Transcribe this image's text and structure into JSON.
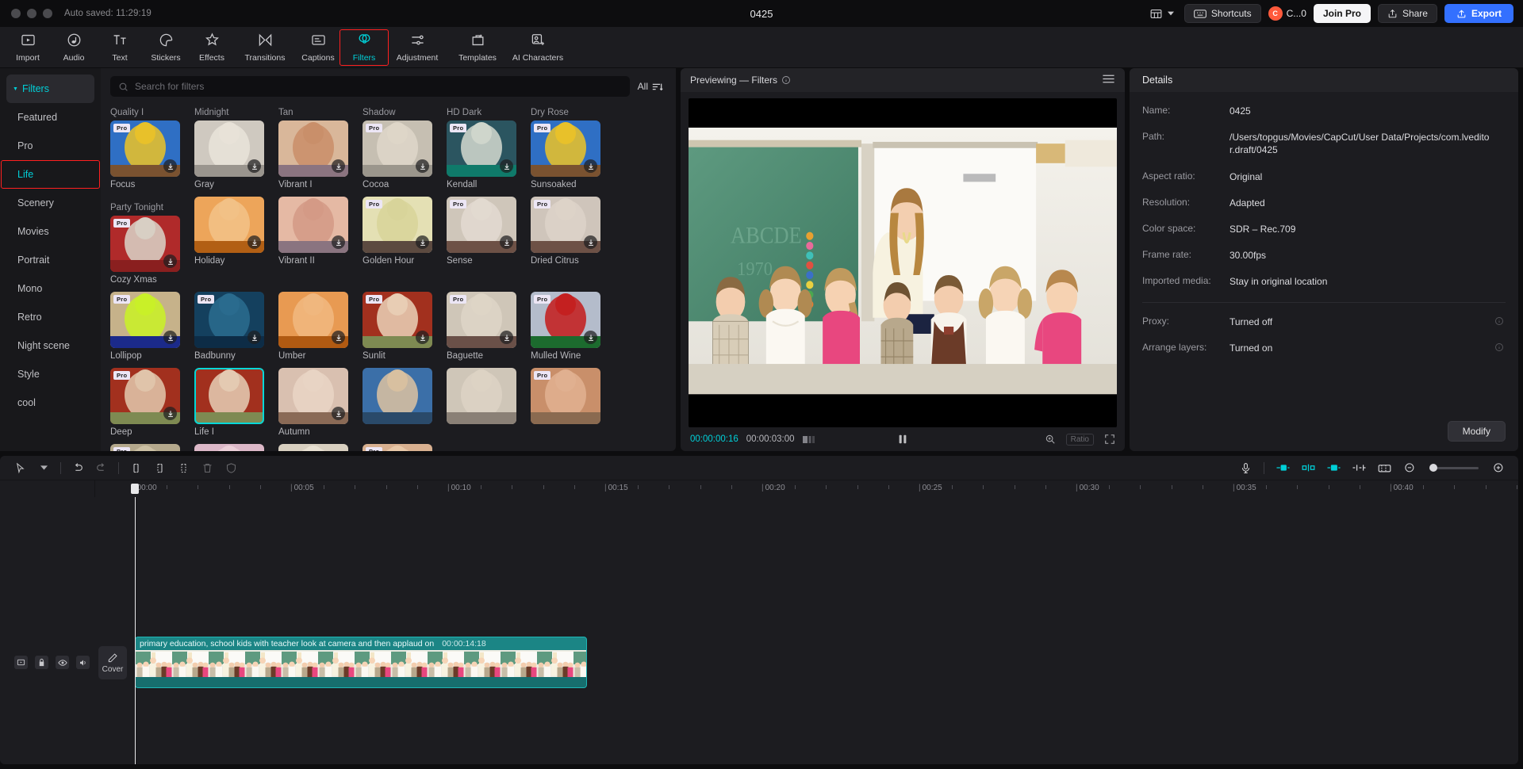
{
  "titlebar": {
    "autosave": "Auto saved: 11:29:19",
    "project_title": "0425",
    "layout_icon": "layout-icon",
    "shortcuts_label": "Shortcuts",
    "account_label": "C...0",
    "account_initial": "C",
    "join_pro_label": "Join Pro",
    "share_label": "Share",
    "export_label": "Export"
  },
  "toolbar": {
    "items": [
      {
        "label": "Import",
        "icon": "import-icon",
        "active": false
      },
      {
        "label": "Audio",
        "icon": "audio-icon",
        "active": false
      },
      {
        "label": "Text",
        "icon": "text-icon",
        "active": false
      },
      {
        "label": "Stickers",
        "icon": "stickers-icon",
        "active": false
      },
      {
        "label": "Effects",
        "icon": "effects-icon",
        "active": false
      },
      {
        "label": "Transitions",
        "icon": "transitions-icon",
        "active": false
      },
      {
        "label": "Captions",
        "icon": "captions-icon",
        "active": false
      },
      {
        "label": "Filters",
        "icon": "filters-icon",
        "active": true
      },
      {
        "label": "Adjustment",
        "icon": "adjustment-icon",
        "active": false
      },
      {
        "label": "Templates",
        "icon": "templates-icon",
        "active": false
      },
      {
        "label": "AI Characters",
        "icon": "ai-characters-icon",
        "active": false
      }
    ]
  },
  "library": {
    "categories": [
      {
        "label": "Filters",
        "header": true,
        "selected": false
      },
      {
        "label": "Featured",
        "header": false,
        "selected": false
      },
      {
        "label": "Pro",
        "header": false,
        "selected": false
      },
      {
        "label": "Life",
        "header": false,
        "selected": true
      },
      {
        "label": "Scenery",
        "header": false,
        "selected": false
      },
      {
        "label": "Movies",
        "header": false,
        "selected": false
      },
      {
        "label": "Portrait",
        "header": false,
        "selected": false
      },
      {
        "label": "Mono",
        "header": false,
        "selected": false
      },
      {
        "label": "Retro",
        "header": false,
        "selected": false
      },
      {
        "label": "Night scene",
        "header": false,
        "selected": false
      },
      {
        "label": "Style",
        "header": false,
        "selected": false
      },
      {
        "label": "cool",
        "header": false,
        "selected": false
      }
    ],
    "search_placeholder": "Search for filters",
    "search_value": "",
    "all_label": "All",
    "column_headers": [
      "Quality I",
      "Midnight",
      "Tan",
      "Shadow",
      "HD Dark",
      "Dry Rose",
      "Party Tonight"
    ],
    "rows": [
      [
        {
          "name": "Focus",
          "pro": true,
          "download": true,
          "selected": false,
          "c1": "#2f6fc4",
          "c2": "#e8c12a",
          "c3": "#7a5230"
        },
        {
          "name": "Gray",
          "pro": false,
          "download": true,
          "selected": false,
          "c1": "#cfc9c0",
          "c2": "#e8e2d8",
          "c3": "#9a958e"
        },
        {
          "name": "Vibrant I",
          "pro": false,
          "download": true,
          "selected": false,
          "c1": "#d9b79a",
          "c2": "#c98f6a",
          "c3": "#8b7480"
        },
        {
          "name": "Cocoa",
          "pro": true,
          "download": true,
          "selected": false,
          "c1": "#c6bfb2",
          "c2": "#ded6c8",
          "c3": "#9b968c"
        },
        {
          "name": "Kendall",
          "pro": true,
          "download": true,
          "selected": false,
          "c1": "#2b5560",
          "c2": "#cfd6cc",
          "c3": "#0f7a6a"
        },
        {
          "name": "Sunsoaked",
          "pro": true,
          "download": true,
          "selected": false,
          "c1": "#2f6fc4",
          "c2": "#e8c12a",
          "c3": "#7a5230"
        },
        {
          "name": "Cozy Xmas",
          "pro": true,
          "download": true,
          "selected": false,
          "c1": "#b02a2a",
          "c2": "#d8cfc4",
          "c3": "#8a1f1f"
        }
      ],
      [
        {
          "name": "Holiday",
          "pro": false,
          "download": true,
          "selected": false,
          "c1": "#eda55a",
          "c2": "#f2c186",
          "c3": "#b25f14"
        },
        {
          "name": "Vibrant II",
          "pro": false,
          "download": true,
          "selected": false,
          "c1": "#e5b9a4",
          "c2": "#d49a86",
          "c3": "#8a7480"
        },
        {
          "name": "Golden Hour",
          "pro": true,
          "download": true,
          "selected": false,
          "c1": "#e4e0b4",
          "c2": "#d8d49a",
          "c3": "#5c4a40"
        },
        {
          "name": "Sense",
          "pro": true,
          "download": true,
          "selected": false,
          "c1": "#cfc6ba",
          "c2": "#e2dad0",
          "c3": "#6d5146"
        },
        {
          "name": "Dried Citrus",
          "pro": true,
          "download": true,
          "selected": false,
          "c1": "#cfc5bb",
          "c2": "#ddd3c8",
          "c3": "#6d5146"
        },
        {
          "name": "Lollipop",
          "pro": true,
          "download": true,
          "selected": false,
          "c1": "#c6b28a",
          "c2": "#c9f028",
          "c3": "#1b2a8a"
        },
        {
          "name": "Badbunny",
          "pro": true,
          "download": true,
          "selected": false,
          "c1": "#14405e",
          "c2": "#2a6b8e",
          "c3": "#0d2c46"
        }
      ],
      [
        {
          "name": "Umber",
          "pro": false,
          "download": true,
          "selected": false,
          "c1": "#e89a52",
          "c2": "#f0b77e",
          "c3": "#b05a12"
        },
        {
          "name": "Sunlit",
          "pro": true,
          "download": true,
          "selected": false,
          "c1": "#a2301e",
          "c2": "#e8cdb4",
          "c3": "#7e8a52"
        },
        {
          "name": "Baguette",
          "pro": true,
          "download": true,
          "selected": false,
          "c1": "#cfc6b8",
          "c2": "#ded5c6",
          "c3": "#6a5048"
        },
        {
          "name": "Mulled Wine",
          "pro": true,
          "download": true,
          "selected": false,
          "c1": "#b4bccb",
          "c2": "#c42020",
          "c3": "#1c6b2e"
        },
        {
          "name": "Deep",
          "pro": true,
          "download": true,
          "selected": false,
          "c1": "#a2301e",
          "c2": "#e0c4aa",
          "c3": "#7e8a52"
        },
        {
          "name": "Life I",
          "pro": false,
          "download": false,
          "selected": true,
          "c1": "#a2301e",
          "c2": "#e4cab2",
          "c3": "#7e8a52"
        },
        {
          "name": "Autumn",
          "pro": false,
          "download": true,
          "selected": false,
          "c1": "#d9c0b0",
          "c2": "#e8d4c4",
          "c3": "#8a6a56"
        }
      ],
      [
        {
          "name": "",
          "pro": false,
          "download": false,
          "selected": false,
          "c1": "#3b6fa8",
          "c2": "#d8c0a0",
          "c3": "#2a4a6a"
        },
        {
          "name": "",
          "pro": false,
          "download": false,
          "selected": false,
          "c1": "#cfc6b8",
          "c2": "#ddd3c4",
          "c3": "#8a8076"
        },
        {
          "name": "",
          "pro": true,
          "download": false,
          "selected": false,
          "c1": "#c98f6a",
          "c2": "#e0b090",
          "c3": "#8a6a50"
        },
        {
          "name": "",
          "pro": true,
          "download": false,
          "selected": false,
          "c1": "#b4a88c",
          "c2": "#ccc0a4",
          "c3": "#6a6050"
        },
        {
          "name": "",
          "pro": false,
          "download": false,
          "selected": false,
          "c1": "#dcb8c8",
          "c2": "#eccfd8",
          "c3": "#a08090"
        },
        {
          "name": "",
          "pro": false,
          "download": false,
          "selected": false,
          "c1": "#d8cfc0",
          "c2": "#e8e0d2",
          "c3": "#9a9084"
        },
        {
          "name": "",
          "pro": true,
          "download": false,
          "selected": false,
          "c1": "#d8b090",
          "c2": "#e8c8a8",
          "c3": "#9a7050"
        }
      ]
    ]
  },
  "preview": {
    "header_title": "Previewing — Filters",
    "info_icon": "info-icon",
    "menu_icon": "hamburger-icon",
    "current_time": "00:00:00:16",
    "total_time": "00:00:03:00",
    "ratio_label": "Ratio",
    "play_state": "pause",
    "icons": [
      "grid-icon",
      "pause-icon",
      "zoom-fit-icon",
      "fullscreen-icon"
    ]
  },
  "details": {
    "title": "Details",
    "rows": [
      {
        "key": "Name:",
        "value": "0425",
        "info": false
      },
      {
        "key": "Path:",
        "value": "/Users/topgus/Movies/CapCut/User Data/Projects/com.lveditor.draft/0425",
        "info": false
      },
      {
        "key": "Aspect ratio:",
        "value": "Original",
        "info": false
      },
      {
        "key": "Resolution:",
        "value": "Adapted",
        "info": false
      },
      {
        "key": "Color space:",
        "value": "SDR – Rec.709",
        "info": false
      },
      {
        "key": "Frame rate:",
        "value": "30.00fps",
        "info": false
      },
      {
        "key": "Imported media:",
        "value": "Stay in original location",
        "info": false
      }
    ],
    "rows2": [
      {
        "key": "Proxy:",
        "value": "Turned off",
        "info": true
      },
      {
        "key": "Arrange layers:",
        "value": "Turned on",
        "info": true
      }
    ],
    "modify_label": "Modify"
  },
  "timeline": {
    "tools_left": [
      "select-cursor-icon",
      "chevron-down-icon",
      "undo-icon",
      "redo-icon",
      "split-icon",
      "trim-left-icon",
      "trim-right-icon",
      "delete-icon",
      "shield-icon"
    ],
    "tools_right": [
      "microphone-icon",
      "keyframe-icon",
      "mirror-icon",
      "crop-icon",
      "speed-icon",
      "freeze-icon",
      "zoom-out-icon",
      "zoom-in-icon"
    ],
    "ruler_labels": [
      "00:00",
      "00:05",
      "00:10",
      "00:15",
      "00:20",
      "00:25",
      "00:30",
      "00:35",
      "00:40"
    ],
    "track_controls": [
      "clip-toggle-icon",
      "lock-icon",
      "eye-icon",
      "volume-icon"
    ],
    "cover_label": "Cover",
    "cover_icon": "pencil-icon",
    "clip": {
      "label": "primary education, school kids with teacher look at camera and then applaud on",
      "duration": "00:00:14:18"
    },
    "playhead_time": "00:00"
  }
}
